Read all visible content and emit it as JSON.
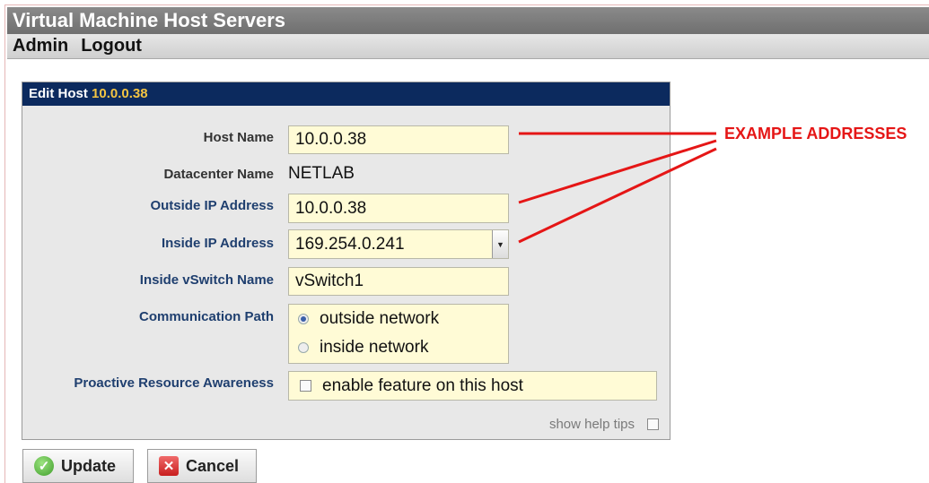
{
  "app": {
    "title": "Virtual Machine Host Servers"
  },
  "menu": {
    "items": [
      {
        "label": "Admin"
      },
      {
        "label": "Logout"
      }
    ]
  },
  "panel": {
    "header_prefix": "Edit Host",
    "header_host": "10.0.0.38",
    "fields": {
      "host_name": {
        "label": "Host Name",
        "value": "10.0.0.38"
      },
      "datacenter_name": {
        "label": "Datacenter Name",
        "value": "NETLAB"
      },
      "outside_ip": {
        "label": "Outside IP Address",
        "value": "10.0.0.38"
      },
      "inside_ip": {
        "label": "Inside IP Address",
        "value": "169.254.0.241"
      },
      "inside_vswitch": {
        "label": "Inside vSwitch Name",
        "value": "vSwitch1"
      },
      "communication_path": {
        "label": "Communication Path",
        "options": [
          {
            "label": "outside network",
            "selected": true
          },
          {
            "label": "inside network",
            "selected": false
          }
        ]
      },
      "proactive": {
        "label": "Proactive Resource Awareness",
        "option_label": "enable feature on this host",
        "checked": false
      }
    },
    "help_tips": {
      "label": "show help tips",
      "checked": false
    }
  },
  "buttons": {
    "update_label": "Update",
    "cancel_label": "Cancel"
  },
  "annotation": {
    "text": "EXAMPLE ADDRESSES",
    "color": "#e51616"
  },
  "colors": {
    "panel_header_bg": "#0c2a5e",
    "header_host_color": "#f5c542",
    "label_color": "#1f3f6f",
    "field_bg": "#fffbd6"
  }
}
